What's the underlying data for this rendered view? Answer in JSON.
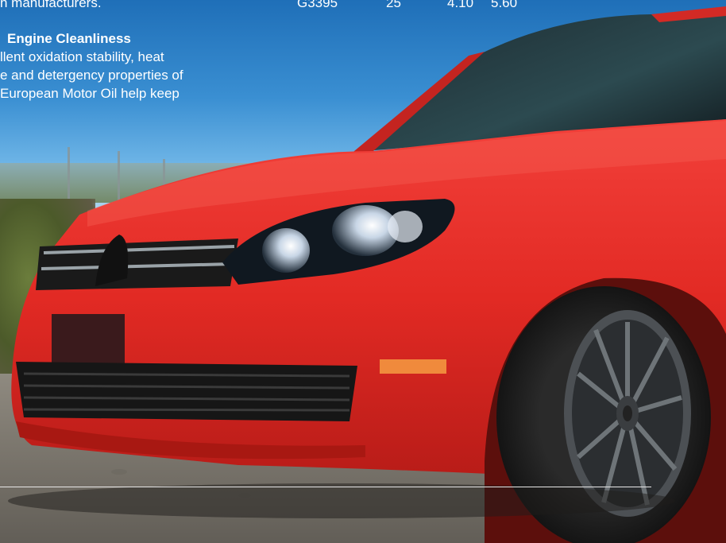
{
  "intro": {
    "tail_text": "n manufacturers."
  },
  "spec_row": {
    "code": "G3395",
    "count": "25",
    "price_a": "4.10",
    "price_b": "5.60"
  },
  "section": {
    "heading": "Engine Cleanliness",
    "line1": "llent oxidation stability, heat",
    "line2": "e and detergency properties of",
    "line3": "European Motor Oil help keep"
  },
  "colors": {
    "car_red": "#e82a26",
    "sky_blue": "#2f82c8",
    "text": "#ffffff"
  }
}
